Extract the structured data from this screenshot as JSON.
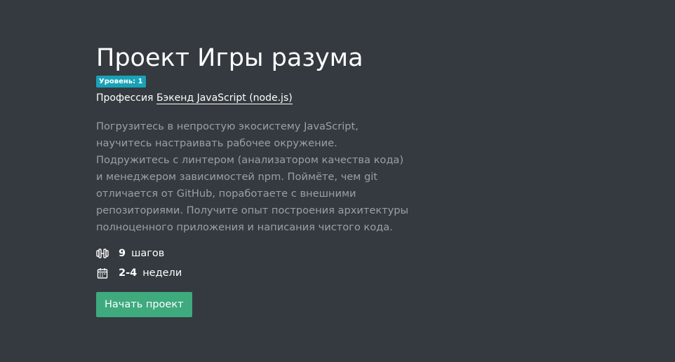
{
  "project": {
    "title": "Проект Игры разума",
    "level_badge": "Уровень: 1",
    "profession_prefix": "Профессия",
    "profession_link": "Бэкенд JavaScript (node.js)",
    "description": "Погрузитесь в непростую экосистему JavaScript, научитесь настраивать рабочее окружение. Подружитесь с линтером (анализатором качества кода) и менеджером зависимостей npm. Поймёте, чем git отличается от GitHub, поработаете с внешними репозиториями. Получите опыт построения архитектуры полноценного приложения и написания чистого кода.",
    "stats": [
      {
        "icon": "dumbbell-icon",
        "value": "9",
        "unit": "шагов"
      },
      {
        "icon": "calendar-icon",
        "value": "2-4",
        "unit": "недели"
      }
    ],
    "start_button": "Начать проект"
  },
  "colors": {
    "background": "#343a40",
    "badge": "#17a2b8",
    "button": "#3eaa7e",
    "muted_text": "#9aa0a6"
  }
}
